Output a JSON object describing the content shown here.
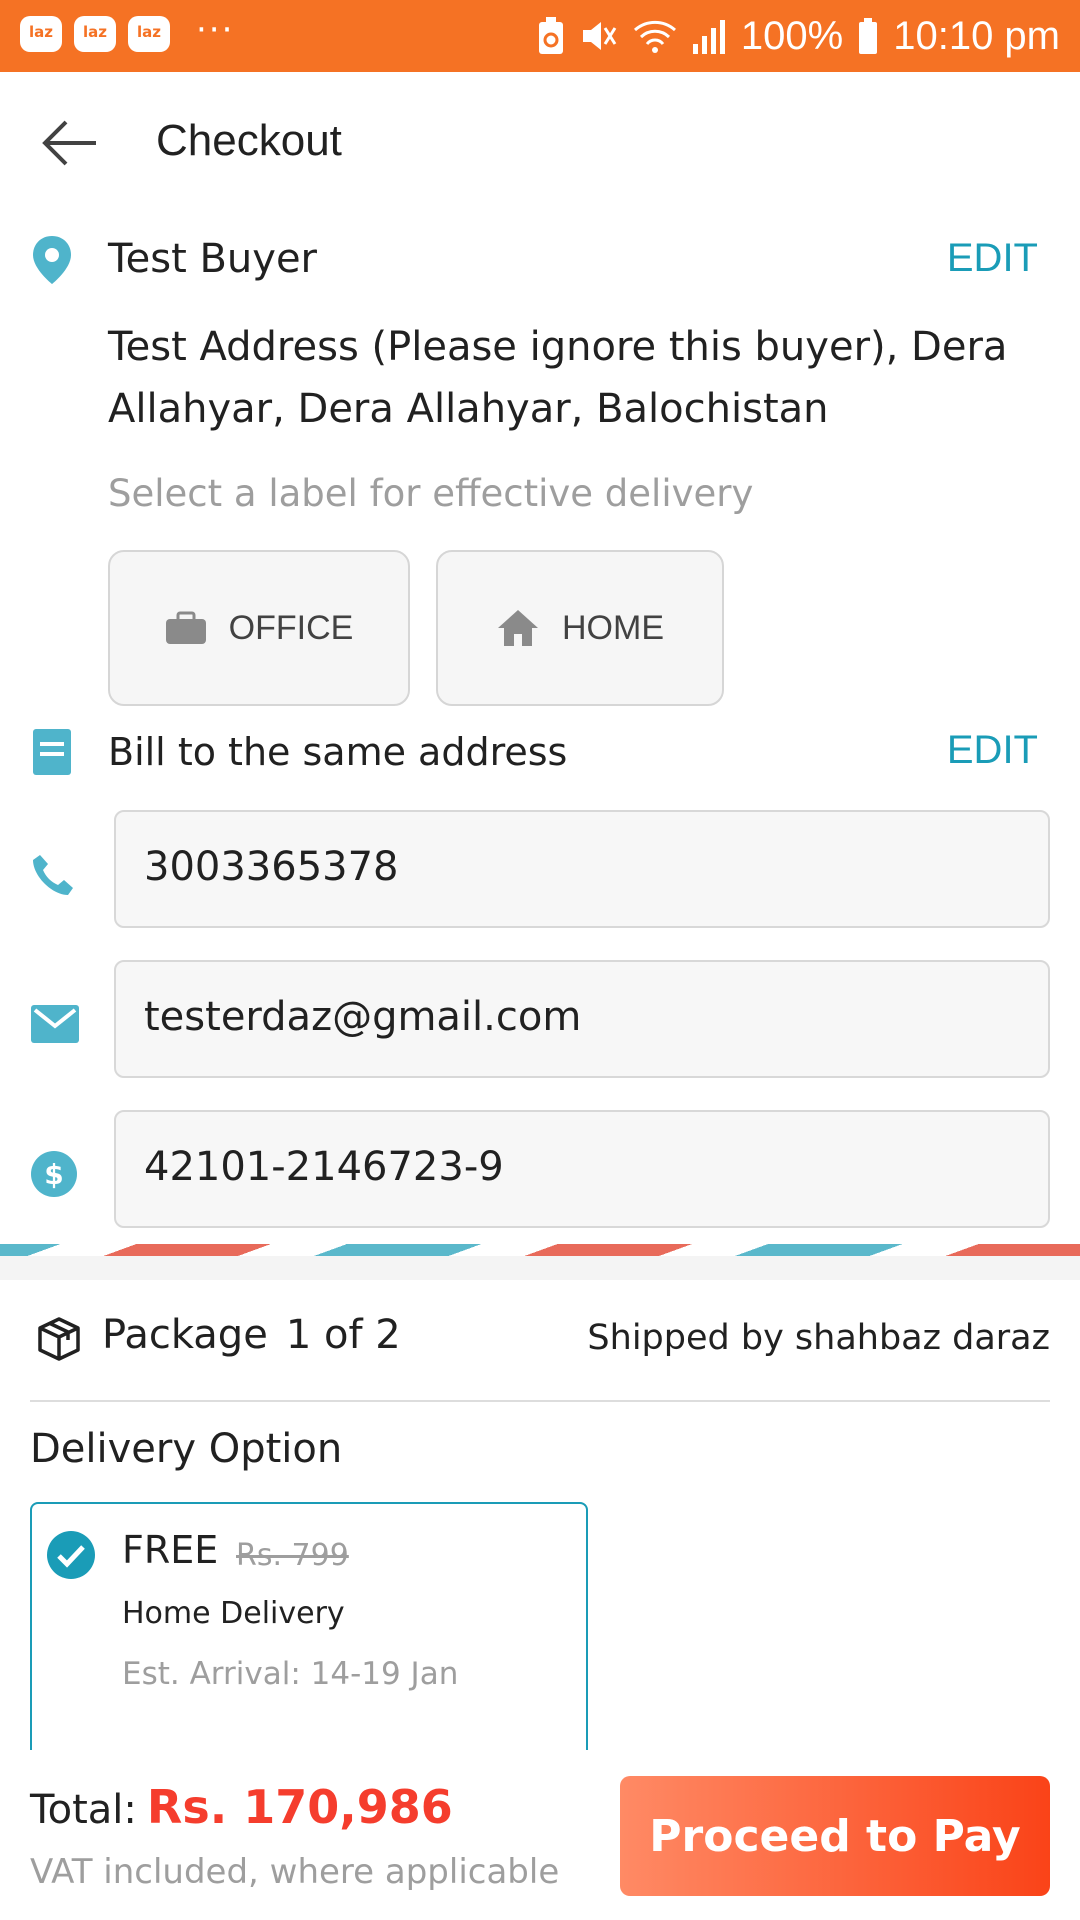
{
  "status_bar": {
    "app_badges": [
      "laz",
      "laz",
      "laz"
    ],
    "overflow": "···",
    "battery": "100%",
    "time": "10:10 pm"
  },
  "header": {
    "title": "Checkout"
  },
  "shipping": {
    "name": "Test Buyer",
    "edit_label": "EDIT",
    "address": "Test Address (Please ignore this buyer), Dera Allahyar, Dera Allahyar, Balochistan",
    "label_hint": "Select a label for effective delivery",
    "labels": [
      "OFFICE",
      "HOME"
    ]
  },
  "billing": {
    "text": "Bill to the same address",
    "edit_label": "EDIT"
  },
  "contact": {
    "phone": "3003365378",
    "email": "testerdaz@gmail.com",
    "cnic": "42101-2146723-9"
  },
  "package": {
    "label": "Package",
    "count": "1 of 2",
    "shipped_by": "Shipped by shahbaz daraz"
  },
  "delivery": {
    "title": "Delivery Option",
    "price": "FREE",
    "original_price": "Rs. 799",
    "method": "Home Delivery",
    "eta": "Est. Arrival: 14-19 Jan"
  },
  "footer": {
    "total_label": "Total:",
    "total_value": "Rs. 170,986",
    "vat_note": "VAT included, where applicable",
    "pay_button": "Proceed to Pay"
  },
  "colors": {
    "brand_orange": "#f57224",
    "accent_teal": "#1a9cb7",
    "price_red": "#f53d2d"
  }
}
